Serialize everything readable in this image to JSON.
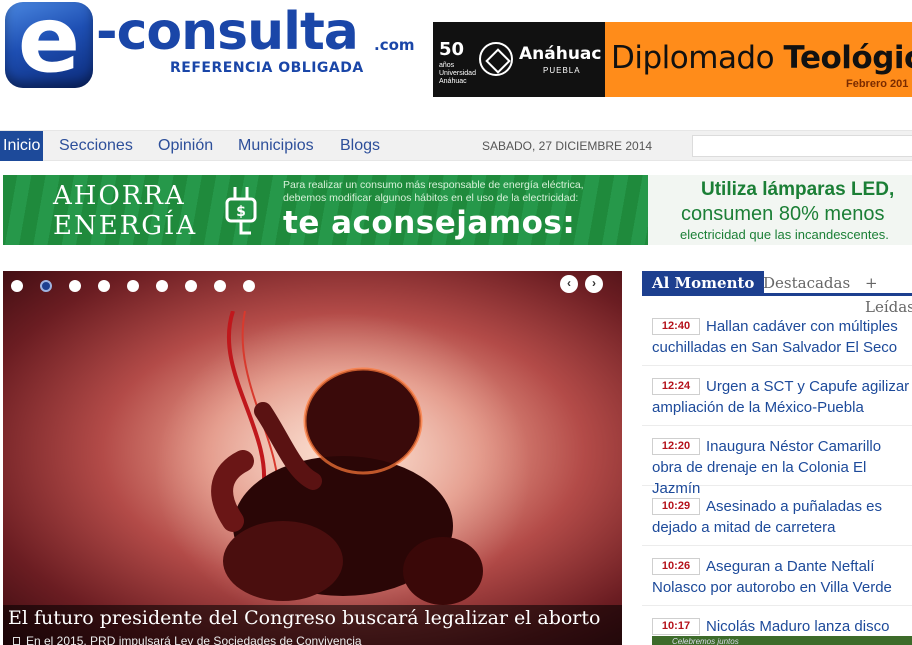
{
  "logo": {
    "letter": "e",
    "word": "-consulta",
    "tld": ".com",
    "tagline": "REFERENCIA OBLIGADA"
  },
  "top_banner": {
    "anniversary": "50",
    "anniversary_sub": "años Universidad Anáhuac",
    "brand": "Anáhuac",
    "city": "PUEBLA",
    "headline_light": "Diplomado ",
    "headline_bold": "Teológic",
    "footer": "Febrero 201"
  },
  "nav": {
    "items": [
      "Inicio",
      "Secciones",
      "Opinión",
      "Municipios",
      "Blogs"
    ],
    "date": "SABADO, 27 DICIEMBRE 2014",
    "search_placeholder": ""
  },
  "energy_banner": {
    "line1": "AHORRA",
    "line2": "ENERGÍA",
    "message": "Para realizar un consumo más responsable de energía eléctrica, debemos modificar algunos hábitos en el uso de la electricidad:",
    "cta": "te aconsejamos:",
    "right1": "Utiliza lámparas LED,",
    "right2": "consumen 80% menos",
    "right3": "electricidad que las incandescentes."
  },
  "slider": {
    "active_dot": 2,
    "dot_count": 9,
    "prev_icon": "‹",
    "next_icon": "›",
    "title": "El futuro presidente del Congreso buscará legalizar el aborto",
    "subtitle": "En el 2015, PRD impulsará Ley de Sociedades de Convivencia"
  },
  "sidebar": {
    "tabs": [
      "Al Momento",
      "Destacadas",
      "+ Leídas"
    ],
    "news": [
      {
        "time": "12:40",
        "text": "Hallan cadáver con múltiples cuchilladas en San Salvador El Seco"
      },
      {
        "time": "12:24",
        "text": "Urgen a SCT y Capufe agilizar ampliación de la México-Puebla"
      },
      {
        "time": "12:20",
        "text": "Inaugura Néstor Camarillo obra de drenaje en la Colonia El Jazmín"
      },
      {
        "time": "10:29",
        "text": "Asesinado a puñaladas es dejado a mitad de carretera"
      },
      {
        "time": "10:26",
        "text": "Aseguran a Dante Neftalí Nolasco por autorobo en Villa Verde"
      },
      {
        "time": "10:17",
        "text": "Nicolás Maduro lanza disco"
      }
    ],
    "bottom_banner": "Celebremos juntos"
  },
  "colors": {
    "brand_blue": "#1a46a8",
    "nav_active": "#1d4a9a",
    "time_red": "#b5121b",
    "banner_green": "#1f8a3c",
    "banner_orange": "#ff8c1a"
  }
}
